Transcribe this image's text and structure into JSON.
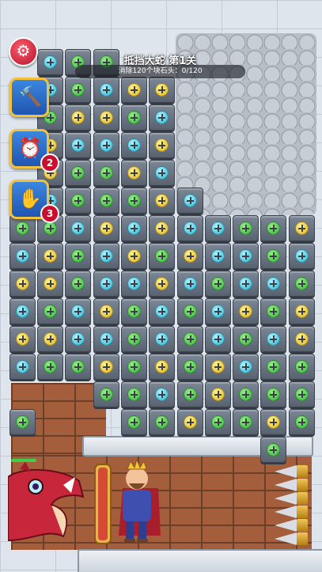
{
  "level": {
    "title": "抵挡大蛇 第1关",
    "objective": "消除120个块石头：0/120"
  },
  "powerups": [
    {
      "name": "hammer",
      "icon": "hammer-icon",
      "count": ""
    },
    {
      "name": "alarm",
      "icon": "alarm-clock-icon",
      "count": "2"
    },
    {
      "name": "hand",
      "icon": "glove-hand-icon",
      "count": "3"
    }
  ],
  "colors": {
    "green": "#2fae3a",
    "yellow": "#e0b515",
    "cyan": "#23b3d3"
  },
  "tiles": [
    {
      "c": 0,
      "r": 0,
      "k": "cyan"
    },
    {
      "c": 1,
      "r": 0,
      "k": "green"
    },
    {
      "c": 2,
      "r": 0,
      "k": "green"
    },
    {
      "c": 0,
      "r": 1,
      "k": "cyan"
    },
    {
      "c": 1,
      "r": 1,
      "k": "green"
    },
    {
      "c": 2,
      "r": 1,
      "k": "cyan"
    },
    {
      "c": 3,
      "r": 1,
      "k": "yellow"
    },
    {
      "c": 4,
      "r": 1,
      "k": "yellow"
    },
    {
      "c": 0,
      "r": 2,
      "k": "green"
    },
    {
      "c": 1,
      "r": 2,
      "k": "yellow"
    },
    {
      "c": 2,
      "r": 2,
      "k": "yellow"
    },
    {
      "c": 3,
      "r": 2,
      "k": "green"
    },
    {
      "c": 4,
      "r": 2,
      "k": "cyan"
    },
    {
      "c": 0,
      "r": 3,
      "k": "yellow"
    },
    {
      "c": 1,
      "r": 3,
      "k": "cyan"
    },
    {
      "c": 2,
      "r": 3,
      "k": "cyan"
    },
    {
      "c": 3,
      "r": 3,
      "k": "cyan"
    },
    {
      "c": 4,
      "r": 3,
      "k": "yellow"
    },
    {
      "c": 0,
      "r": 4,
      "k": "yellow"
    },
    {
      "c": 1,
      "r": 4,
      "k": "green"
    },
    {
      "c": 2,
      "r": 4,
      "k": "green"
    },
    {
      "c": 3,
      "r": 4,
      "k": "yellow"
    },
    {
      "c": 4,
      "r": 4,
      "k": "cyan"
    },
    {
      "c": 0,
      "r": 5,
      "k": "cyan"
    },
    {
      "c": 1,
      "r": 5,
      "k": "green"
    },
    {
      "c": 2,
      "r": 5,
      "k": "green"
    },
    {
      "c": 3,
      "r": 5,
      "k": "green"
    },
    {
      "c": 4,
      "r": 5,
      "k": "yellow"
    },
    {
      "c": 5,
      "r": 5,
      "k": "cyan"
    },
    {
      "c": -1,
      "r": 6,
      "k": "green"
    },
    {
      "c": 0,
      "r": 6,
      "k": "green"
    },
    {
      "c": 1,
      "r": 6,
      "k": "cyan"
    },
    {
      "c": 2,
      "r": 6,
      "k": "yellow"
    },
    {
      "c": 3,
      "r": 6,
      "k": "cyan"
    },
    {
      "c": 4,
      "r": 6,
      "k": "yellow"
    },
    {
      "c": 5,
      "r": 6,
      "k": "cyan"
    },
    {
      "c": 6,
      "r": 6,
      "k": "cyan"
    },
    {
      "c": 7,
      "r": 6,
      "k": "green"
    },
    {
      "c": 8,
      "r": 6,
      "k": "green"
    },
    {
      "c": 9,
      "r": 6,
      "k": "yellow"
    },
    {
      "c": -1,
      "r": 7,
      "k": "cyan"
    },
    {
      "c": 0,
      "r": 7,
      "k": "yellow"
    },
    {
      "c": 1,
      "r": 7,
      "k": "green"
    },
    {
      "c": 2,
      "r": 7,
      "k": "cyan"
    },
    {
      "c": 3,
      "r": 7,
      "k": "yellow"
    },
    {
      "c": 4,
      "r": 7,
      "k": "green"
    },
    {
      "c": 5,
      "r": 7,
      "k": "yellow"
    },
    {
      "c": 6,
      "r": 7,
      "k": "cyan"
    },
    {
      "c": 7,
      "r": 7,
      "k": "cyan"
    },
    {
      "c": 8,
      "r": 7,
      "k": "green"
    },
    {
      "c": 9,
      "r": 7,
      "k": "cyan"
    },
    {
      "c": -1,
      "r": 8,
      "k": "yellow"
    },
    {
      "c": 0,
      "r": 8,
      "k": "yellow"
    },
    {
      "c": 1,
      "r": 8,
      "k": "green"
    },
    {
      "c": 2,
      "r": 8,
      "k": "cyan"
    },
    {
      "c": 3,
      "r": 8,
      "k": "cyan"
    },
    {
      "c": 4,
      "r": 8,
      "k": "yellow"
    },
    {
      "c": 5,
      "r": 8,
      "k": "cyan"
    },
    {
      "c": 6,
      "r": 8,
      "k": "green"
    },
    {
      "c": 7,
      "r": 8,
      "k": "cyan"
    },
    {
      "c": 8,
      "r": 8,
      "k": "cyan"
    },
    {
      "c": 9,
      "r": 8,
      "k": "green"
    },
    {
      "c": -1,
      "r": 9,
      "k": "cyan"
    },
    {
      "c": 0,
      "r": 9,
      "k": "green"
    },
    {
      "c": 1,
      "r": 9,
      "k": "cyan"
    },
    {
      "c": 2,
      "r": 9,
      "k": "yellow"
    },
    {
      "c": 3,
      "r": 9,
      "k": "green"
    },
    {
      "c": 4,
      "r": 9,
      "k": "cyan"
    },
    {
      "c": 5,
      "r": 9,
      "k": "green"
    },
    {
      "c": 6,
      "r": 9,
      "k": "cyan"
    },
    {
      "c": 7,
      "r": 9,
      "k": "yellow"
    },
    {
      "c": 8,
      "r": 9,
      "k": "green"
    },
    {
      "c": 9,
      "r": 9,
      "k": "yellow"
    },
    {
      "c": -1,
      "r": 10,
      "k": "yellow"
    },
    {
      "c": 0,
      "r": 10,
      "k": "yellow"
    },
    {
      "c": 1,
      "r": 10,
      "k": "cyan"
    },
    {
      "c": 2,
      "r": 10,
      "k": "cyan"
    },
    {
      "c": 3,
      "r": 10,
      "k": "green"
    },
    {
      "c": 4,
      "r": 10,
      "k": "cyan"
    },
    {
      "c": 5,
      "r": 10,
      "k": "green"
    },
    {
      "c": 6,
      "r": 10,
      "k": "cyan"
    },
    {
      "c": 7,
      "r": 10,
      "k": "green"
    },
    {
      "c": 8,
      "r": 10,
      "k": "cyan"
    },
    {
      "c": 9,
      "r": 10,
      "k": "yellow"
    },
    {
      "c": -1,
      "r": 11,
      "k": "cyan"
    },
    {
      "c": 0,
      "r": 11,
      "k": "green"
    },
    {
      "c": 1,
      "r": 11,
      "k": "green"
    },
    {
      "c": 2,
      "r": 11,
      "k": "yellow"
    },
    {
      "c": 3,
      "r": 11,
      "k": "green"
    },
    {
      "c": 4,
      "r": 11,
      "k": "yellow"
    },
    {
      "c": 5,
      "r": 11,
      "k": "green"
    },
    {
      "c": 6,
      "r": 11,
      "k": "yellow"
    },
    {
      "c": 7,
      "r": 11,
      "k": "cyan"
    },
    {
      "c": 8,
      "r": 11,
      "k": "green"
    },
    {
      "c": 9,
      "r": 11,
      "k": "green"
    },
    {
      "c": 2,
      "r": 12,
      "k": "green"
    },
    {
      "c": 3,
      "r": 12,
      "k": "green"
    },
    {
      "c": 4,
      "r": 12,
      "k": "cyan"
    },
    {
      "c": 5,
      "r": 12,
      "k": "green"
    },
    {
      "c": 6,
      "r": 12,
      "k": "yellow"
    },
    {
      "c": 7,
      "r": 12,
      "k": "green"
    },
    {
      "c": 8,
      "r": 12,
      "k": "green"
    },
    {
      "c": 9,
      "r": 12,
      "k": "green"
    },
    {
      "c": -1,
      "r": 13,
      "k": "green"
    },
    {
      "c": 3,
      "r": 13,
      "k": "green"
    },
    {
      "c": 4,
      "r": 13,
      "k": "green"
    },
    {
      "c": 5,
      "r": 13,
      "k": "yellow"
    },
    {
      "c": 6,
      "r": 13,
      "k": "green"
    },
    {
      "c": 7,
      "r": 13,
      "k": "green"
    },
    {
      "c": 8,
      "r": 13,
      "k": "yellow"
    },
    {
      "c": 9,
      "r": 13,
      "k": "green"
    },
    {
      "c": 8,
      "r": 14,
      "k": "green"
    }
  ]
}
